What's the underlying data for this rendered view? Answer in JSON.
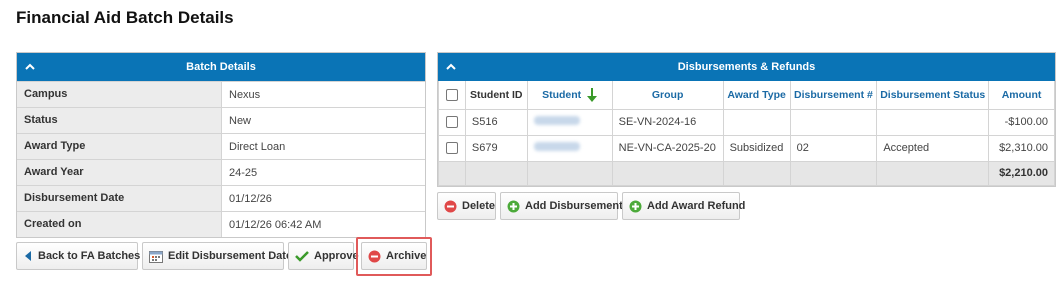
{
  "page": {
    "title": "Financial Aid Batch Details"
  },
  "batch_details": {
    "header": "Batch Details",
    "rows": [
      {
        "label": "Campus",
        "value": "Nexus"
      },
      {
        "label": "Status",
        "value": "New"
      },
      {
        "label": "Award Type",
        "value": "Direct Loan"
      },
      {
        "label": "Award Year",
        "value": "24-25"
      },
      {
        "label": "Disbursement Date",
        "value": "01/12/26"
      },
      {
        "label": "Created on",
        "value": "01/12/26 06:42 AM"
      }
    ],
    "buttons": {
      "back": "Back to FA Batches",
      "edit_date": "Edit Disbursement Date",
      "approve": "Approve",
      "archive": "Archive"
    }
  },
  "disbursements": {
    "header": "Disbursements & Refunds",
    "columns": {
      "student_id": "Student ID",
      "student": "Student",
      "group": "Group",
      "award_type": "Award Type",
      "disbursement_no": "Disbursement #",
      "disbursement_status": "Disbursement Status",
      "amount": "Amount"
    },
    "rows": [
      {
        "student_id": "S516",
        "group": "SE-VN-2024-16",
        "award_type": "",
        "disbursement_no": "",
        "disbursement_status": "",
        "amount": "-$100.00"
      },
      {
        "student_id": "S679",
        "group": "NE-VN-CA-2025-20",
        "award_type": "Subsidized",
        "disbursement_no": "02",
        "disbursement_status": "Accepted",
        "amount": "$2,310.00"
      }
    ],
    "total": "$2,210.00",
    "buttons": {
      "delete": "Delete",
      "add_disbursement": "Add Disbursement",
      "add_award_refund": "Add Award Refund"
    }
  },
  "colors": {
    "header_blue": "#0a74b6",
    "link_blue": "#1b6aa5",
    "highlight_red": "#e05a5a"
  }
}
